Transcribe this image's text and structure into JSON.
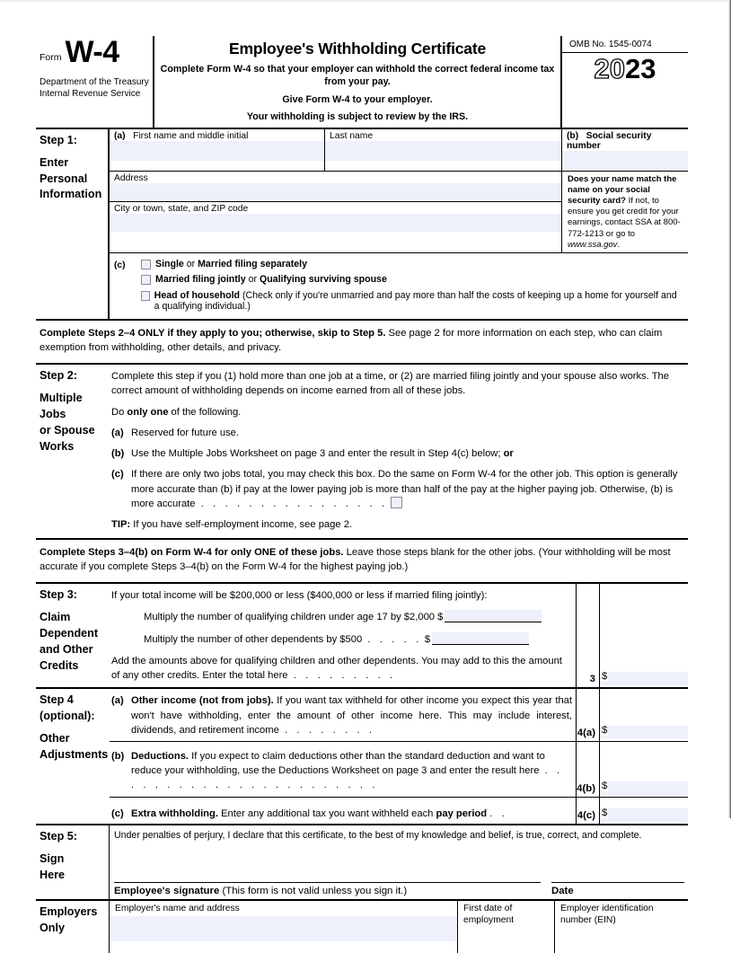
{
  "form": {
    "form_word": "Form",
    "form_number": "W-4",
    "department_line1": "Department of the Treasury",
    "department_line2": "Internal Revenue Service",
    "title": "Employee's Withholding Certificate",
    "subtitle_line1": "Complete Form W-4 so that your employer can withhold the correct federal income tax from your pay.",
    "subtitle_line2": "Give Form W-4 to your employer.",
    "subtitle_line3": "Your withholding is subject to review by the IRS.",
    "omb": "OMB No. 1545-0074",
    "year_hollow": "20",
    "year_solid": "23"
  },
  "step1": {
    "label_line1": "Step 1:",
    "label_line2": "Enter",
    "label_line3": "Personal",
    "label_line4": "Information",
    "a_marker": "(a)",
    "a_label": "First name and middle initial",
    "last_name_label": "Last name",
    "b_marker": "(b)",
    "b_label": "Social security number",
    "address_label": "Address",
    "city_label": "City or town, state, and ZIP code",
    "note_bold": "Does your name match the name on your social security card?",
    "note_rest": " If not, to ensure you get credit for your earnings, contact SSA at 800-772-1213 or go to ",
    "note_url": "www.ssa.gov",
    "note_end": ".",
    "c_marker": "(c)",
    "filing_options": [
      {
        "bold1": "Single",
        "mid": " or ",
        "bold2": "Married filing separately",
        "rest": ""
      },
      {
        "bold1": "Married filing jointly",
        "mid": " or ",
        "bold2": "Qualifying surviving spouse",
        "rest": ""
      },
      {
        "bold1": "Head of household",
        "mid": "",
        "bold2": "",
        "rest": " (Check only if you're unmarried and pay more than half the costs of keeping up a home for yourself and a qualifying individual.)"
      }
    ]
  },
  "band1": {
    "bold": "Complete Steps 2–4 ONLY if they apply to you; otherwise, skip to Step 5.",
    "rest": " See page 2 for more information on each step, who can claim exemption from withholding, other details, and privacy."
  },
  "step2": {
    "label_line1": "Step 2:",
    "label_line2": "Multiple Jobs",
    "label_line3": "or Spouse",
    "label_line4": "Works",
    "intro": "Complete this step if you (1) hold more than one job at a time, or (2) are married filing jointly and your spouse also works. The correct amount of withholding depends on income earned from all of these jobs.",
    "do_pre": "Do ",
    "do_bold": "only one",
    "do_post": " of the following.",
    "a_marker": "(a)",
    "a_text": "Reserved for future use.",
    "b_marker": "(b)",
    "b_text": "Use the Multiple Jobs Worksheet on page 3 and enter the result in Step 4(c) below; ",
    "b_text_bold": "or",
    "c_marker": "(c)",
    "c_text": "If there are only two jobs total, you may check this box. Do the same on Form W-4 for the other job. This option is generally more accurate than (b) if pay at the lower paying job is more than half of the pay at the higher paying job. Otherwise, (b) is more accurate",
    "c_dots": ". . . . . . . . . . . . . . . .",
    "tip_bold": "TIP:",
    "tip_rest": " If you have self-employment income, see page 2."
  },
  "band2": {
    "bold": "Complete Steps 3–4(b) on Form W-4 for only ONE of these jobs.",
    "rest": " Leave those steps blank for the other jobs. (Your withholding will be most accurate if you complete Steps 3–4(b) on the Form W-4 for the highest paying job.)"
  },
  "step3": {
    "label_line1": "Step 3:",
    "label_line2": "Claim",
    "label_line3": "Dependent",
    "label_line4": "and Other",
    "label_line5": "Credits",
    "intro": "If your total income will be $200,000 or less ($400,000 or less if married filing jointly):",
    "line1": "Multiply the number of qualifying children under age 17 by $2,000",
    "line1_dollar": "$",
    "line2": "Multiply the number of other dependents by $500",
    "line2_dots": ". . . . .",
    "line2_dollar": "$",
    "total_text": "Add the amounts above for qualifying children and other dependents. You may add to this the amount of any other credits. Enter the total here",
    "total_dots": ". . . . . . . . .",
    "line_number": "3",
    "amount_symbol": "$"
  },
  "step4": {
    "label_line1": "Step 4",
    "label_line2": "(optional):",
    "label_line3": "Other",
    "label_line4": "Adjustments",
    "a_marker": "(a)",
    "a_bold": "Other income (not from jobs).",
    "a_text": " If you want tax withheld for other income you expect this year that won't have withholding, enter the amount of other income here. This may include interest, dividends, and retirement income",
    "a_dots": ". . . . . . . .",
    "a_number": "4(a)",
    "b_marker": "(b)",
    "b_bold": "Deductions.",
    "b_text": " If you expect to claim deductions other than the standard deduction and want to reduce your withholding, use the Deductions Worksheet on page 3 and enter the result here",
    "b_dots": ". . . . . . . . . . . . . . . . . . . . . . .",
    "b_number": "4(b)",
    "c_marker": "(c)",
    "c_bold": "Extra withholding.",
    "c_text": " Enter any additional tax you want withheld each ",
    "c_bold2": "pay period",
    "c_dots": ". .",
    "c_number": "4(c)",
    "amount_symbol": "$"
  },
  "step5": {
    "label_line1": "Step 5:",
    "label_line2": "Sign",
    "label_line3": "Here",
    "declaration": "Under penalties of perjury, I declare that this certificate, to the best of my knowledge and belief, is true, correct, and complete.",
    "signature_bold": "Employee's signature",
    "signature_rest": " (This form is not valid unless you sign it.)",
    "date_label": "Date"
  },
  "employers": {
    "label_line1": "Employers",
    "label_line2": "Only",
    "name_label": "Employer's name and address",
    "date_label_line1": "First date of",
    "date_label_line2": "employment",
    "ein_label_line1": "Employer identification",
    "ein_label_line2": "number (EIN)"
  },
  "colors": {
    "field_fill": "#eef0fb",
    "checkbox_border": "#8a8a96",
    "rule": "#000000"
  }
}
